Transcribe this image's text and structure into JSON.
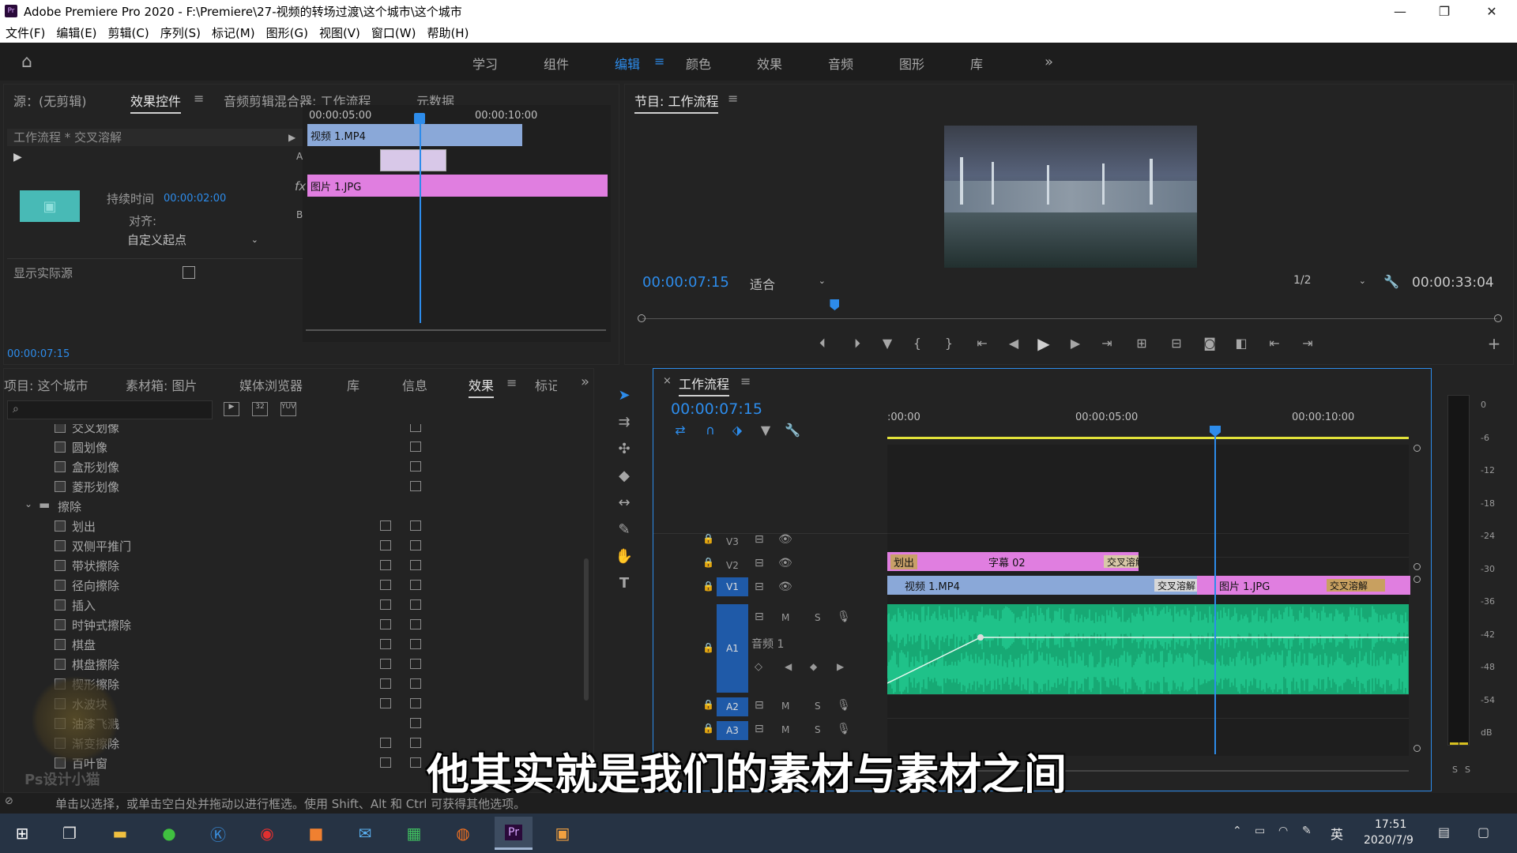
{
  "window": {
    "title": "Adobe Premiere Pro 2020 - F:\\Premiere\\27-视频的转场过渡\\这个城市\\这个城市",
    "app_icon": "Pr",
    "controls": [
      "—",
      "❐",
      "✕"
    ]
  },
  "menu": [
    "文件(F)",
    "编辑(E)",
    "剪辑(C)",
    "序列(S)",
    "标记(M)",
    "图形(G)",
    "视图(V)",
    "窗口(W)",
    "帮助(H)"
  ],
  "workspaces": [
    "学习",
    "组件",
    "编辑",
    "颜色",
    "效果",
    "音频",
    "图形",
    "库"
  ],
  "workspace_active": "编辑",
  "workspace_more": "»",
  "source_panel": {
    "tabs": [
      "源：(无剪辑)",
      "效果控件",
      "音频剪辑混合器: 工作流程",
      "元数据"
    ],
    "active_tab": "效果控件",
    "clip_title": "工作流程 * 交叉溶解",
    "timecode_start": "00:00:05:00",
    "timecode_end": "00:00:10:00",
    "clip_a": "视频 1.MP4",
    "clip_b": "图片 1.JPG",
    "label_a": "A",
    "label_b": "B",
    "fx": "fx",
    "duration_label": "持续时间",
    "duration_value": "00:00:02:00",
    "align_label": "对齐:",
    "align_value": "自定义起点",
    "show_source_label": "显示实际源",
    "timecode": "00:00:07:15"
  },
  "program_panel": {
    "title": "节目: 工作流程",
    "timecode": "00:00:07:15",
    "fit": "适合",
    "quality": "1/2",
    "duration": "00:00:33:04",
    "playhead_fraction": 0.225
  },
  "project_panel": {
    "tabs": [
      "项目: 这个城市",
      "素材箱: 图片",
      "媒体浏览器",
      "库",
      "信息",
      "效果",
      "标记"
    ],
    "active_tab": "效果",
    "folder": "擦除",
    "effects_above": [
      "交叉划像",
      "圆划像",
      "盒形划像",
      "菱形划像"
    ],
    "effects": [
      {
        "name": "划出",
        "badges": 2
      },
      {
        "name": "双侧平推门",
        "badges": 2
      },
      {
        "name": "带状擦除",
        "badges": 2
      },
      {
        "name": "径向擦除",
        "badges": 2
      },
      {
        "name": "插入",
        "badges": 2
      },
      {
        "name": "时钟式擦除",
        "badges": 2
      },
      {
        "name": "棋盘",
        "badges": 2
      },
      {
        "name": "棋盘擦除",
        "badges": 2
      },
      {
        "name": "楔形擦除",
        "badges": 2
      },
      {
        "name": "水波块",
        "badges": 2
      },
      {
        "name": "油漆飞溅",
        "badges": 1
      },
      {
        "name": "渐变擦除",
        "badges": 2
      },
      {
        "name": "百叶窗",
        "badges": 2
      }
    ]
  },
  "timeline": {
    "title": "工作流程",
    "timecode": "00:00:07:15",
    "ruler": [
      ":00:00",
      "00:00:05:00",
      "00:00:10:00"
    ],
    "tracks": [
      "V3",
      "V2",
      "V1",
      "A1",
      "A2",
      "A3"
    ],
    "audio_track_name": "音频 1",
    "clips": {
      "v2_a": "划出",
      "v2_b": "字幕 02",
      "v2_c": "交叉溶解",
      "v1_a": "视频 1.MP4",
      "v1_b": "交叉溶解",
      "v1_c": "图片 1.JPG",
      "v1_d": "交叉溶解"
    },
    "mute": "M",
    "solo": "S"
  },
  "meter": {
    "scale": [
      "0",
      "-6",
      "-12",
      "-18",
      "-24",
      "-30",
      "-36",
      "-42",
      "-48",
      "-54",
      "dB"
    ],
    "solo_l": "S",
    "solo_r": "S"
  },
  "subtitle": "他其实就是我们的素材与素材之间",
  "status_bar": "单击以选择，或单击空白处并拖动以进行框选。使用 Shift、Alt 和 Ctrl 可获得其他选项。",
  "taskbar": {
    "ime": "英",
    "time": "17:51",
    "date": "2020/7/9"
  },
  "watermark": "Ps设计小猫",
  "colors": {
    "accent_blue": "#2d8ceb",
    "video_clip": "#8aa8d8",
    "image_clip": "#e07ee0",
    "audio_wave": "#1fc289"
  }
}
